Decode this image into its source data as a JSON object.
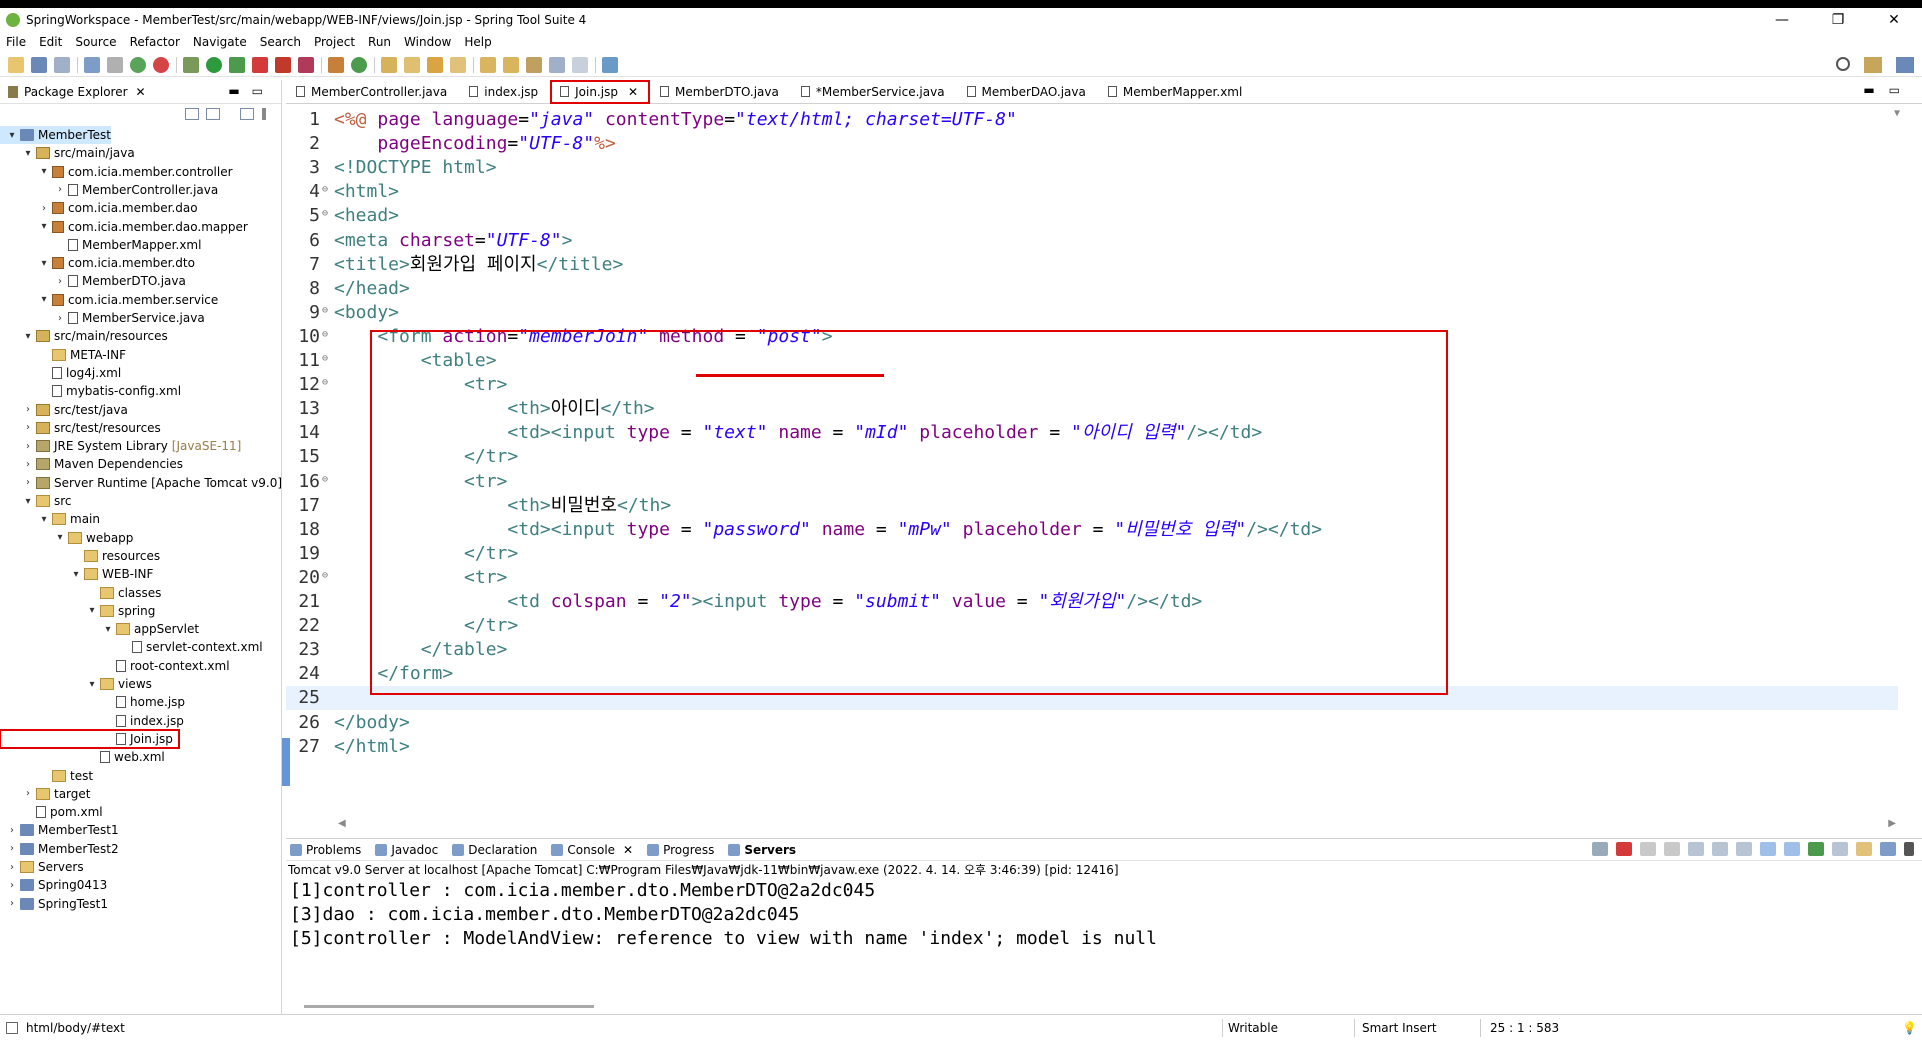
{
  "window": {
    "title": "SpringWorkspace - MemberTest/src/main/webapp/WEB-INF/views/Join.jsp - Spring Tool Suite 4",
    "controls": [
      "—",
      "❐",
      "✕"
    ]
  },
  "menu": [
    "File",
    "Edit",
    "Source",
    "Refactor",
    "Navigate",
    "Search",
    "Project",
    "Run",
    "Window",
    "Help"
  ],
  "package_explorer": {
    "title": "Package Explorer",
    "tree": [
      {
        "depth": 0,
        "toggle": "▾",
        "icon": "project",
        "label": "MemberTest",
        "selected": true
      },
      {
        "depth": 1,
        "toggle": "▾",
        "icon": "srcfolder",
        "label": "src/main/java"
      },
      {
        "depth": 2,
        "toggle": "▾",
        "icon": "package",
        "label": "com.icia.member.controller"
      },
      {
        "depth": 3,
        "toggle": "›",
        "icon": "java",
        "label": "MemberController.java"
      },
      {
        "depth": 2,
        "toggle": "›",
        "icon": "package",
        "label": "com.icia.member.dao"
      },
      {
        "depth": 2,
        "toggle": "▾",
        "icon": "package",
        "label": "com.icia.member.dao.mapper"
      },
      {
        "depth": 3,
        "toggle": "",
        "icon": "xml",
        "label": "MemberMapper.xml"
      },
      {
        "depth": 2,
        "toggle": "▾",
        "icon": "package",
        "label": "com.icia.member.dto"
      },
      {
        "depth": 3,
        "toggle": "›",
        "icon": "java",
        "label": "MemberDTO.java"
      },
      {
        "depth": 2,
        "toggle": "▾",
        "icon": "package",
        "label": "com.icia.member.service"
      },
      {
        "depth": 3,
        "toggle": "›",
        "icon": "java",
        "label": "MemberService.java"
      },
      {
        "depth": 1,
        "toggle": "▾",
        "icon": "srcfolder",
        "label": "src/main/resources"
      },
      {
        "depth": 2,
        "toggle": "",
        "icon": "folder",
        "label": "META-INF"
      },
      {
        "depth": 2,
        "toggle": "",
        "icon": "xml",
        "label": "log4j.xml"
      },
      {
        "depth": 2,
        "toggle": "",
        "icon": "xml",
        "label": "mybatis-config.xml"
      },
      {
        "depth": 1,
        "toggle": "›",
        "icon": "srcfolder",
        "label": "src/test/java"
      },
      {
        "depth": 1,
        "toggle": "›",
        "icon": "srcfolder",
        "label": "src/test/resources"
      },
      {
        "depth": 1,
        "toggle": "›",
        "icon": "lib",
        "label": "JRE System Library",
        "decor": "[JavaSE-11]"
      },
      {
        "depth": 1,
        "toggle": "›",
        "icon": "lib",
        "label": "Maven Dependencies"
      },
      {
        "depth": 1,
        "toggle": "›",
        "icon": "lib",
        "label": "Server Runtime [Apache Tomcat v9.0]"
      },
      {
        "depth": 1,
        "toggle": "▾",
        "icon": "folder",
        "label": "src"
      },
      {
        "depth": 2,
        "toggle": "▾",
        "icon": "folder",
        "label": "main"
      },
      {
        "depth": 3,
        "toggle": "▾",
        "icon": "folder",
        "label": "webapp"
      },
      {
        "depth": 4,
        "toggle": "",
        "icon": "folder",
        "label": "resources"
      },
      {
        "depth": 4,
        "toggle": "▾",
        "icon": "folder",
        "label": "WEB-INF"
      },
      {
        "depth": 5,
        "toggle": "",
        "icon": "folder",
        "label": "classes"
      },
      {
        "depth": 5,
        "toggle": "▾",
        "icon": "folder",
        "label": "spring"
      },
      {
        "depth": 6,
        "toggle": "▾",
        "icon": "folder",
        "label": "appServlet"
      },
      {
        "depth": 7,
        "toggle": "",
        "icon": "xml",
        "label": "servlet-context.xml"
      },
      {
        "depth": 6,
        "toggle": "",
        "icon": "xml",
        "label": "root-context.xml"
      },
      {
        "depth": 5,
        "toggle": "▾",
        "icon": "folder",
        "label": "views"
      },
      {
        "depth": 6,
        "toggle": "",
        "icon": "jsp",
        "label": "home.jsp"
      },
      {
        "depth": 6,
        "toggle": "",
        "icon": "jsp",
        "label": "index.jsp"
      },
      {
        "depth": 6,
        "toggle": "",
        "icon": "jsp",
        "label": "Join.jsp",
        "highlight": true
      },
      {
        "depth": 5,
        "toggle": "",
        "icon": "xml",
        "label": "web.xml"
      },
      {
        "depth": 2,
        "toggle": "",
        "icon": "folder",
        "label": "test"
      },
      {
        "depth": 1,
        "toggle": "›",
        "icon": "folder",
        "label": "target"
      },
      {
        "depth": 1,
        "toggle": "",
        "icon": "pom",
        "label": "pom.xml"
      },
      {
        "depth": 0,
        "toggle": "›",
        "icon": "project",
        "label": "MemberTest1"
      },
      {
        "depth": 0,
        "toggle": "›",
        "icon": "project",
        "label": "MemberTest2"
      },
      {
        "depth": 0,
        "toggle": "›",
        "icon": "folder",
        "label": "Servers"
      },
      {
        "depth": 0,
        "toggle": "›",
        "icon": "project",
        "label": "Spring0413"
      },
      {
        "depth": 0,
        "toggle": "›",
        "icon": "project",
        "label": "SpringTest1"
      }
    ]
  },
  "editor": {
    "tabs": [
      {
        "label": "MemberController.java"
      },
      {
        "label": "index.jsp"
      },
      {
        "label": "Join.jsp",
        "active": true
      },
      {
        "label": "MemberDTO.java"
      },
      {
        "label": "*MemberService.java"
      },
      {
        "label": "MemberDAO.java"
      },
      {
        "label": "MemberMapper.xml"
      }
    ],
    "lines": [
      {
        "n": "1",
        "fold": "",
        "segs": [
          [
            "k",
            "<%@ "
          ],
          [
            "a",
            "page "
          ],
          [
            "a",
            "language"
          ],
          [
            "txt",
            "="
          ],
          [
            "v",
            "\"java\""
          ],
          [
            "txt",
            " "
          ],
          [
            "a",
            "contentType"
          ],
          [
            "txt",
            "="
          ],
          [
            "v",
            "\"text/html; charset=UTF-8\""
          ]
        ]
      },
      {
        "n": "2",
        "fold": "",
        "segs": [
          [
            "txt",
            "    "
          ],
          [
            "a",
            "pageEncoding"
          ],
          [
            "txt",
            "="
          ],
          [
            "v",
            "\"UTF-8\""
          ],
          [
            "k",
            "%>"
          ]
        ]
      },
      {
        "n": "3",
        "fold": "",
        "segs": [
          [
            "t",
            "<!DOCTYPE "
          ],
          [
            "t",
            "html"
          ],
          [
            "t",
            ">"
          ]
        ]
      },
      {
        "n": "4",
        "fold": "⊖",
        "segs": [
          [
            "t",
            "<html>"
          ]
        ]
      },
      {
        "n": "5",
        "fold": "⊖",
        "segs": [
          [
            "t",
            "<head>"
          ]
        ]
      },
      {
        "n": "6",
        "fold": "",
        "segs": [
          [
            "t",
            "<meta "
          ],
          [
            "a",
            "charset"
          ],
          [
            "txt",
            "="
          ],
          [
            "v",
            "\"UTF-8\""
          ],
          [
            "t",
            ">"
          ]
        ]
      },
      {
        "n": "7",
        "fold": "",
        "segs": [
          [
            "t",
            "<title>"
          ],
          [
            "txt",
            "회원가입 페이지"
          ],
          [
            "t",
            "</title>"
          ]
        ]
      },
      {
        "n": "8",
        "fold": "",
        "segs": [
          [
            "t",
            "</head>"
          ]
        ]
      },
      {
        "n": "9",
        "fold": "⊖",
        "segs": [
          [
            "t",
            "<body>"
          ]
        ]
      },
      {
        "n": "10",
        "fold": "⊖",
        "segs": [
          [
            "txt",
            "    "
          ],
          [
            "t",
            "<form "
          ],
          [
            "a",
            "action"
          ],
          [
            "txt",
            "="
          ],
          [
            "v",
            "\"memberJoin\""
          ],
          [
            "txt",
            " "
          ],
          [
            "a",
            "method"
          ],
          [
            "txt",
            " = "
          ],
          [
            "v",
            "\"post\""
          ],
          [
            "t",
            ">"
          ]
        ]
      },
      {
        "n": "11",
        "fold": "⊖",
        "segs": [
          [
            "txt",
            "        "
          ],
          [
            "t",
            "<table>"
          ]
        ]
      },
      {
        "n": "12",
        "fold": "⊖",
        "segs": [
          [
            "txt",
            "            "
          ],
          [
            "t",
            "<tr>"
          ]
        ]
      },
      {
        "n": "13",
        "fold": "",
        "segs": [
          [
            "txt",
            "                "
          ],
          [
            "t",
            "<th>"
          ],
          [
            "txt",
            "아이디"
          ],
          [
            "t",
            "</th>"
          ]
        ]
      },
      {
        "n": "14",
        "fold": "",
        "segs": [
          [
            "txt",
            "                "
          ],
          [
            "t",
            "<td><input "
          ],
          [
            "a",
            "type"
          ],
          [
            "txt",
            " = "
          ],
          [
            "v",
            "\"text\""
          ],
          [
            "txt",
            " "
          ],
          [
            "a",
            "name"
          ],
          [
            "txt",
            " = "
          ],
          [
            "v",
            "\"mId\""
          ],
          [
            "txt",
            " "
          ],
          [
            "a",
            "placeholder"
          ],
          [
            "txt",
            " = "
          ],
          [
            "v",
            "\"아이디 입력\""
          ],
          [
            "t",
            "/></td>"
          ]
        ]
      },
      {
        "n": "15",
        "fold": "",
        "segs": [
          [
            "txt",
            "            "
          ],
          [
            "t",
            "</tr>"
          ]
        ]
      },
      {
        "n": "16",
        "fold": "⊖",
        "segs": [
          [
            "txt",
            "            "
          ],
          [
            "t",
            "<tr>"
          ]
        ]
      },
      {
        "n": "17",
        "fold": "",
        "segs": [
          [
            "txt",
            "                "
          ],
          [
            "t",
            "<th>"
          ],
          [
            "txt",
            "비밀번호"
          ],
          [
            "t",
            "</th>"
          ]
        ]
      },
      {
        "n": "18",
        "fold": "",
        "segs": [
          [
            "txt",
            "                "
          ],
          [
            "t",
            "<td><input "
          ],
          [
            "a",
            "type"
          ],
          [
            "txt",
            " = "
          ],
          [
            "v",
            "\"password\""
          ],
          [
            "txt",
            " "
          ],
          [
            "a",
            "name"
          ],
          [
            "txt",
            " = "
          ],
          [
            "v",
            "\"mPw\""
          ],
          [
            "txt",
            " "
          ],
          [
            "a",
            "placeholder"
          ],
          [
            "txt",
            " = "
          ],
          [
            "v",
            "\"비밀번호 입력\""
          ],
          [
            "t",
            "/></td>"
          ]
        ]
      },
      {
        "n": "19",
        "fold": "",
        "segs": [
          [
            "txt",
            "            "
          ],
          [
            "t",
            "</tr>"
          ]
        ]
      },
      {
        "n": "20",
        "fold": "⊖",
        "segs": [
          [
            "txt",
            "            "
          ],
          [
            "t",
            "<tr>"
          ]
        ]
      },
      {
        "n": "21",
        "fold": "",
        "segs": [
          [
            "txt",
            "                "
          ],
          [
            "t",
            "<td "
          ],
          [
            "a",
            "colspan"
          ],
          [
            "txt",
            " = "
          ],
          [
            "v",
            "\"2\""
          ],
          [
            "t",
            "><input "
          ],
          [
            "a",
            "type"
          ],
          [
            "txt",
            " = "
          ],
          [
            "v",
            "\"submit\""
          ],
          [
            "txt",
            " "
          ],
          [
            "a",
            "value"
          ],
          [
            "txt",
            " = "
          ],
          [
            "v",
            "\"회원가입\""
          ],
          [
            "t",
            "/></td>"
          ]
        ]
      },
      {
        "n": "22",
        "fold": "",
        "segs": [
          [
            "txt",
            "            "
          ],
          [
            "t",
            "</tr>"
          ]
        ]
      },
      {
        "n": "23",
        "fold": "",
        "segs": [
          [
            "txt",
            "        "
          ],
          [
            "t",
            "</table>"
          ]
        ]
      },
      {
        "n": "24",
        "fold": "",
        "segs": [
          [
            "txt",
            "    "
          ],
          [
            "t",
            "</form>"
          ]
        ]
      },
      {
        "n": "25",
        "fold": "",
        "segs": [
          [
            "txt",
            ""
          ]
        ],
        "current": true
      },
      {
        "n": "26",
        "fold": "",
        "segs": [
          [
            "t",
            "</body>"
          ]
        ]
      },
      {
        "n": "27",
        "fold": "",
        "segs": [
          [
            "t",
            "</html>"
          ]
        ]
      }
    ]
  },
  "bottom_panel": {
    "tabs": [
      {
        "label": "Problems"
      },
      {
        "label": "Javadoc"
      },
      {
        "label": "Declaration"
      },
      {
        "label": "Console",
        "closable": true
      },
      {
        "label": "Progress"
      },
      {
        "label": "Servers",
        "bold": true
      }
    ],
    "console_header": "Tomcat v9.0 Server at localhost [Apache Tomcat] C:₩Program Files₩Java₩jdk-11₩bin₩javaw.exe  (2022. 4. 14. 오후 3:46:39) [pid: 12416]",
    "output": [
      "[1]controller : com.icia.member.dto.MemberDTO@2a2dc045",
      "[3]dao : com.icia.member.dto.MemberDTO@2a2dc045",
      "[5]controller : ModelAndView: reference to view with name 'index'; model is null"
    ]
  },
  "status_bar": {
    "path": "html/body/#text",
    "mode": "Writable",
    "insert": "Smart Insert",
    "position": "25 : 1 : 583"
  },
  "colors": {
    "highlight_red": "#e00000",
    "tag": "#3f7f7f",
    "attr": "#7f007f",
    "value": "#2a00ff",
    "current_line": "#e8f2fe"
  }
}
